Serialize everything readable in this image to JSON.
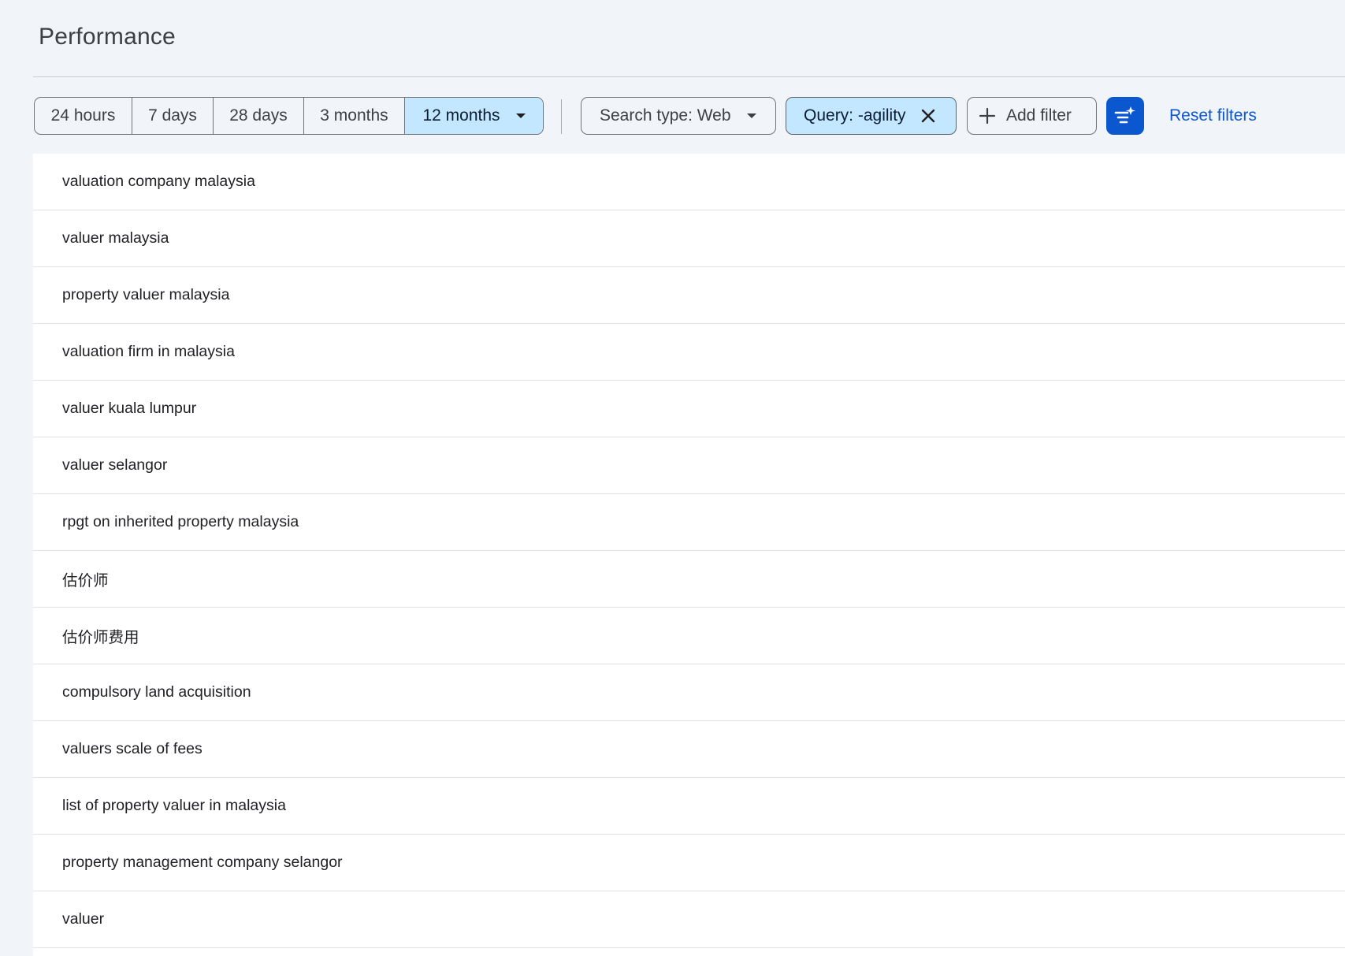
{
  "page": {
    "title": "Performance"
  },
  "date_range": {
    "options": [
      "24 hours",
      "7 days",
      "28 days",
      "3 months",
      "12 months"
    ],
    "selected": "12 months"
  },
  "filters": {
    "search_type_label": "Search type: Web",
    "query_filter_label": "Query: -agility",
    "add_filter_label": "Add filter",
    "reset_label": "Reset filters"
  },
  "colors": {
    "accent": "#0b57d0",
    "active_chip": "#c3e7ff",
    "background": "#f1f4f9"
  },
  "queries": [
    "valuation company malaysia",
    "valuer malaysia",
    "property valuer malaysia",
    "valuation firm in malaysia",
    "valuer kuala lumpur",
    "valuer selangor",
    "rpgt on inherited property malaysia",
    "估价师",
    "估价师费用",
    "compulsory land acquisition",
    "valuers scale of fees",
    "list of property valuer in malaysia",
    "property management company selangor",
    "valuer"
  ]
}
